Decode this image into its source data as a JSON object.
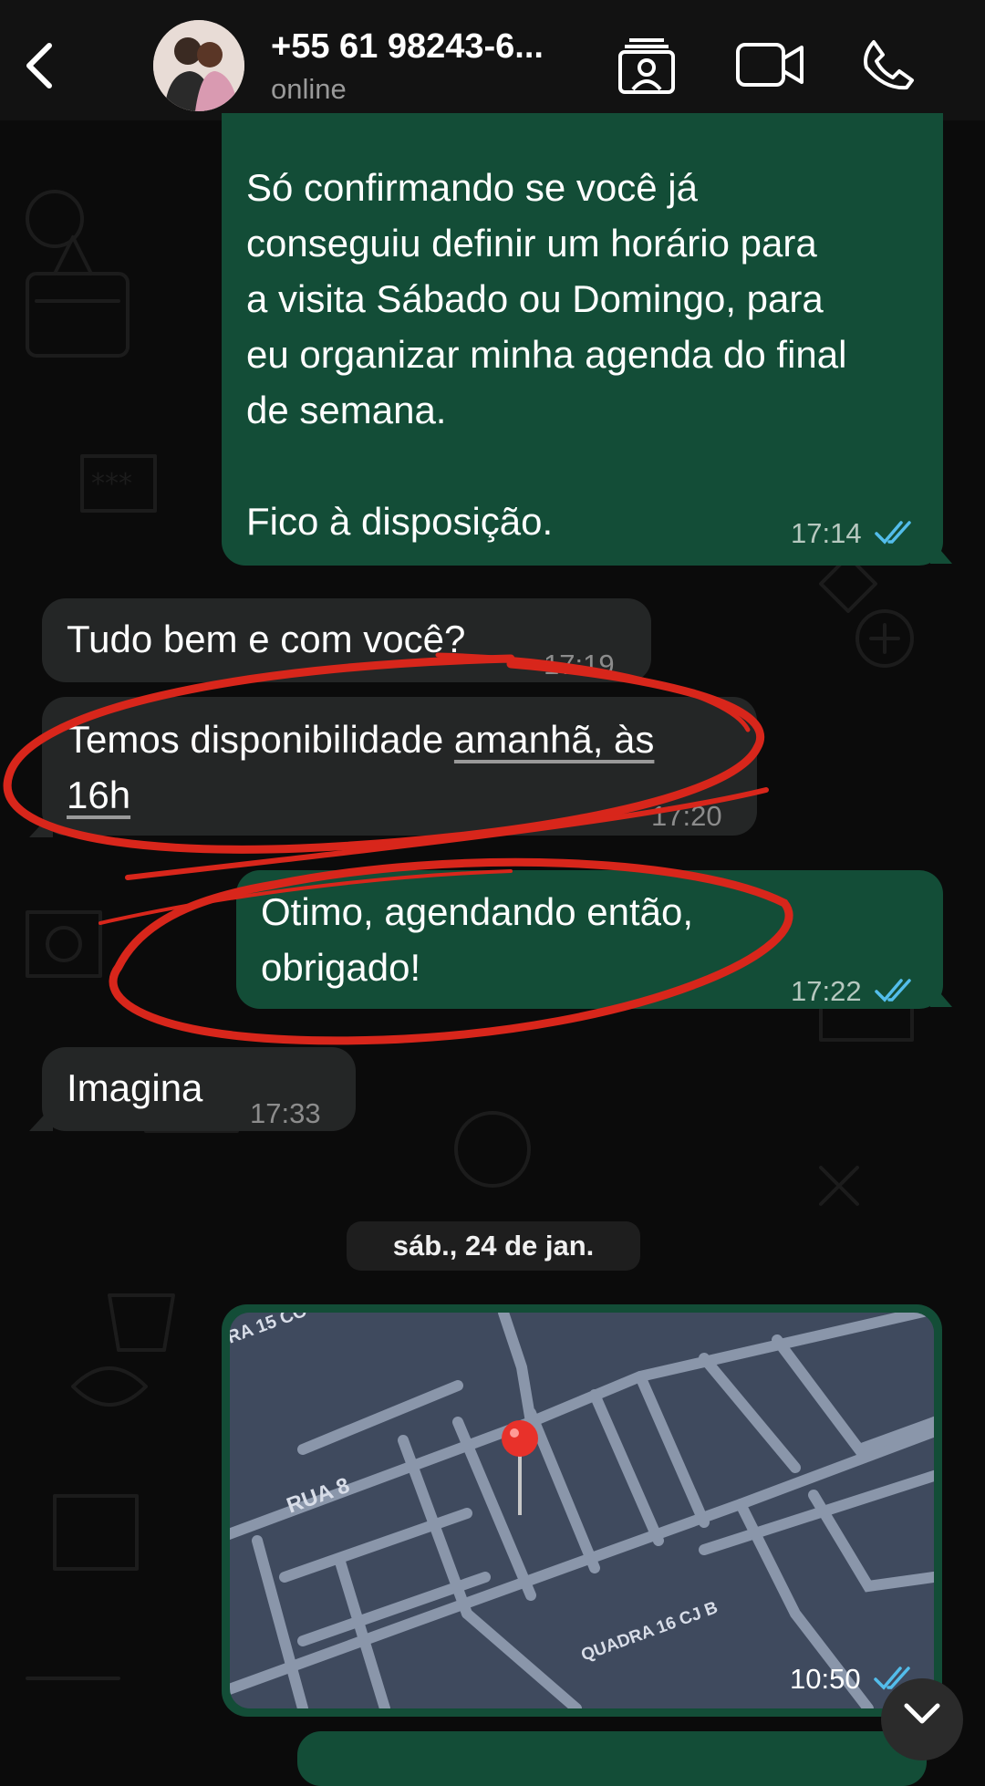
{
  "header": {
    "contact_name": "+55 61 98243-6...",
    "status": "online",
    "icons": [
      "back-arrow-icon",
      "contact-card-icon",
      "video-call-icon",
      "phone-call-icon"
    ]
  },
  "messages": [
    {
      "id": "m1",
      "direction": "outgoing",
      "text": "Só confirmando se você já\nconseguiu definir um horário para\na visita Sábado ou Domingo, para\neu organizar minha agenda do final\nde semana.\n\nFico à disposição.",
      "time": "17:14",
      "status": "read"
    },
    {
      "id": "m2",
      "direction": "incoming",
      "text": "Tudo bem e com você?",
      "time": "17:19"
    },
    {
      "id": "m3",
      "direction": "incoming",
      "text_plain": "Temos disponibilidade ",
      "text_link_1": "amanhã, às",
      "text_link_2": "16h",
      "time": "17:20"
    },
    {
      "id": "m4",
      "direction": "outgoing",
      "text": "Otimo, agendando então,\nobrigado!",
      "time": "17:22",
      "status": "read"
    },
    {
      "id": "m5",
      "direction": "incoming",
      "text": "Imagina",
      "time": "17:33"
    }
  ],
  "date_separator": "sáb., 24 de jan.",
  "location_message": {
    "street_labels": [
      "RA 15 CO",
      "RUA 8",
      "QUADRA 16 CJ B"
    ],
    "time": "10:50",
    "status": "read"
  },
  "colors": {
    "outgoing_bubble": "#134d37",
    "incoming_bubble": "#242626",
    "read_ticks": "#53bdeb",
    "annotation_red": "#d8261b"
  }
}
